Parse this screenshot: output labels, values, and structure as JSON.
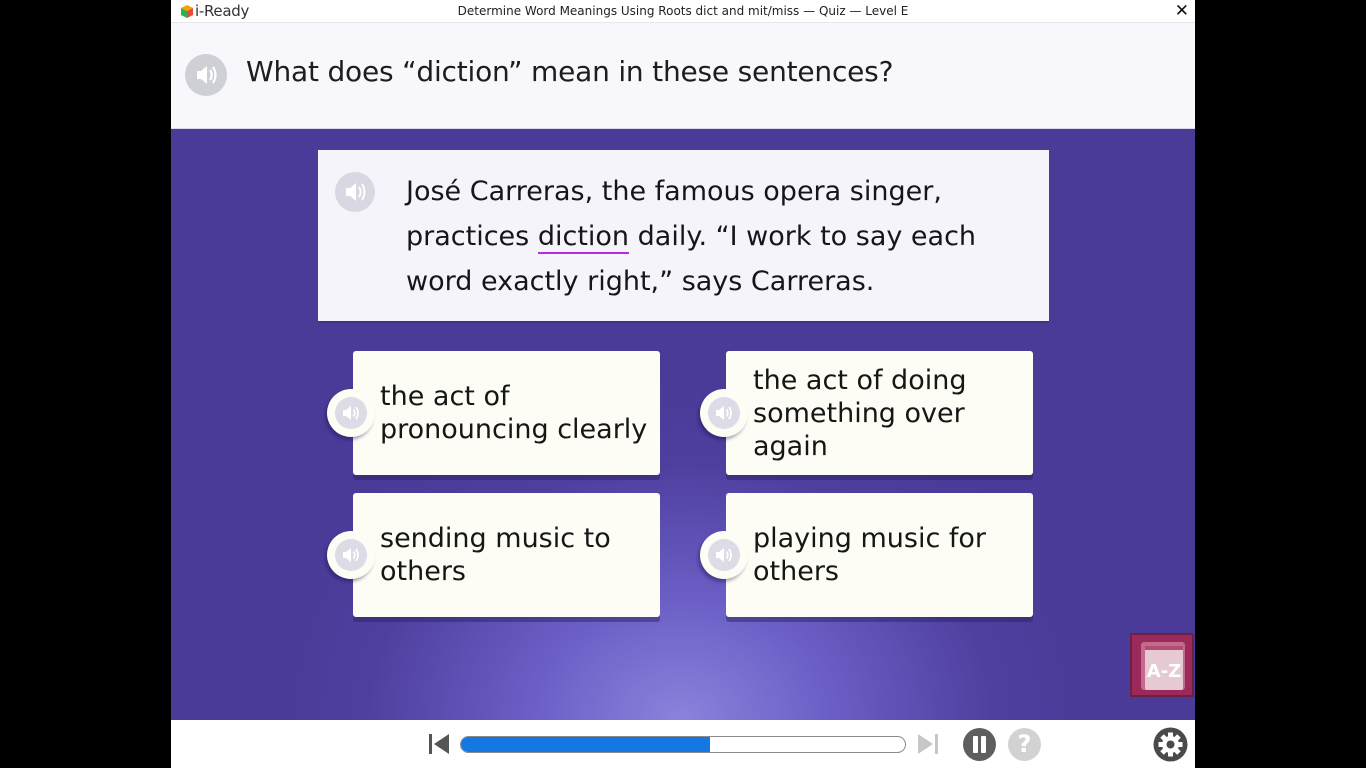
{
  "header": {
    "logo_text": "i-Ready",
    "lesson_title": "Determine Word Meanings Using Roots dict and mit/miss — Quiz — Level E",
    "close_glyph": "✕"
  },
  "question": {
    "text": "What does “diction” mean in these sentences?",
    "audio_icon": "speaker-icon"
  },
  "passage": {
    "before": "José Carreras, the famous opera singer, practices ",
    "target_word": "diction",
    "after": " daily. “I work to say each word exactly right,” says Carreras.",
    "underline_color": "#b82be0"
  },
  "answers": [
    {
      "label": "the act of pronouncing clearly"
    },
    {
      "label": "the act of doing something over again"
    },
    {
      "label": "sending music to others"
    },
    {
      "label": "playing music for others"
    }
  ],
  "glossary": {
    "label": "A-Z",
    "icon": "book-icon"
  },
  "footer": {
    "progress": 0.56,
    "help_glyph": "?",
    "progress_color": "#1477e2"
  },
  "colors": {
    "stage": "#4e3f9f",
    "card": "#fdfdf6",
    "glossary": "#9a2a5c"
  }
}
